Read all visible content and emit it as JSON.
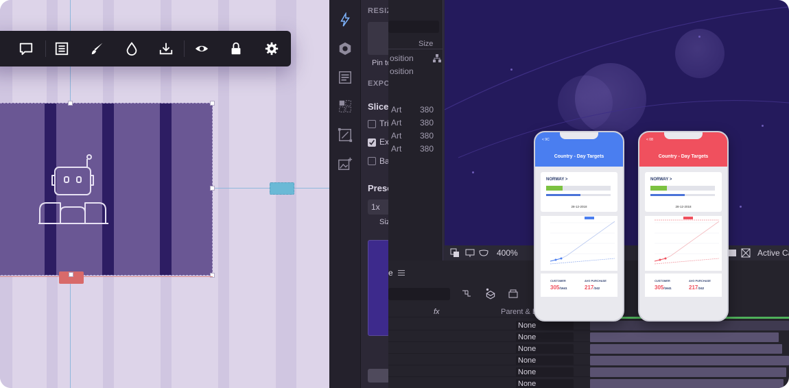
{
  "left_panel": {
    "toolbar_icons": [
      "comment-icon",
      "list-icon",
      "brush-icon",
      "drop-icon",
      "download-icon",
      "eye-icon",
      "lock-icon",
      "gear-icon"
    ]
  },
  "inspector": {
    "resize_heading": "RESIZ",
    "pin_to": "Pin to",
    "export_heading": "EXPO",
    "slices_label": "Slices",
    "slice_options": [
      {
        "label": "Tri",
        "checked": false
      },
      {
        "label": "Ex",
        "checked": true
      },
      {
        "label": "Ba",
        "checked": false
      }
    ],
    "presets_label": "Prese",
    "scale_value": "1x",
    "size_label": "Siz"
  },
  "layers_panel": {
    "size_header": "Size",
    "position_rows": [
      "osition",
      "osition"
    ],
    "rows": [
      {
        "name": "Art",
        "size": "380"
      },
      {
        "name": "Art",
        "size": "380"
      },
      {
        "name": "Art",
        "size": "380"
      },
      {
        "name": "Art",
        "size": "380"
      }
    ]
  },
  "composition": {
    "zoom": "400%",
    "active_camera": "Active Ca"
  },
  "timeline": {
    "tab_label": "e",
    "parent_header": "Parent & Li",
    "fx_label": "fx",
    "parent_values": [
      "None",
      "None",
      "None",
      "None",
      "None",
      "None"
    ]
  },
  "phones": [
    {
      "accent": "#4a7ef0",
      "back": "< 9C",
      "title": "Country - Day Targets",
      "country": "NORWAY >",
      "date": "28-12-2018",
      "customer_label": "CUSTOMER",
      "customer_value": "305",
      "customer_total": "/1641",
      "purchase_label": "AVG PURCHASE",
      "purchase_value": "217",
      "purchase_total": "/242"
    },
    {
      "accent": "#f0505e",
      "back": "< 08",
      "title": "Country - Day Targets",
      "country": "NORWAY >",
      "date": "28-12-2018",
      "customer_label": "CUSTOMER",
      "customer_value": "305",
      "customer_total": "/1641",
      "purchase_label": "AVG PURCHASE",
      "purchase_value": "217",
      "purchase_total": "/242"
    }
  ]
}
